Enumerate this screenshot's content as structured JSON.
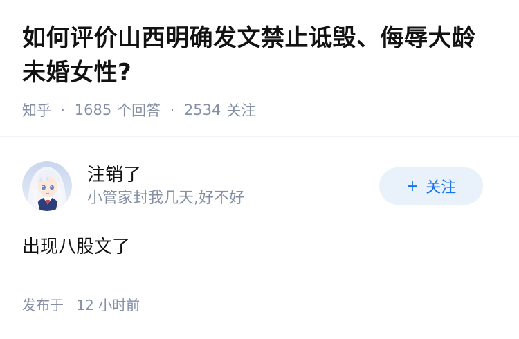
{
  "question": {
    "title": "如何评价山西明确发文禁止诋毁、侮辱大龄未婚女性?",
    "source": "知乎",
    "answer_count": "1685",
    "answer_count_label": "个回答",
    "follower_count": "2534",
    "follower_count_label": "关注",
    "separator": "·"
  },
  "answer": {
    "author_name": "注销了",
    "author_bio": "小管家封我几天,好不好",
    "follow_label": "关注",
    "follow_plus": "+",
    "content": "出现八股文了",
    "published_label": "发布于",
    "published_time": "12 小时前"
  },
  "colors": {
    "meta_gray": "#8590a6",
    "follow_blue": "#1772f6",
    "follow_bg": "#e9f1fb"
  },
  "icons": {
    "avatar": "anime-girl-avatar"
  }
}
